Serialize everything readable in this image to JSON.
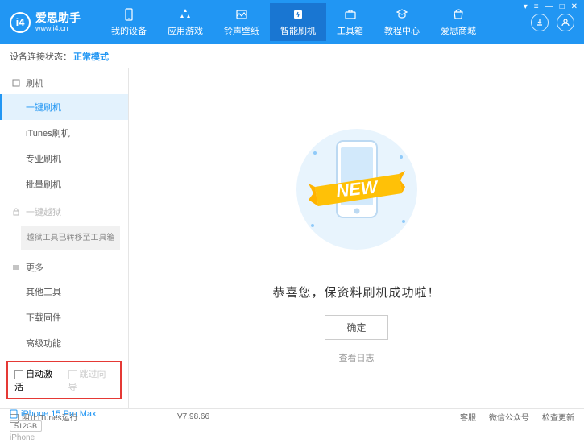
{
  "app": {
    "title": "爱思助手",
    "url": "www.i4.cn"
  },
  "nav": [
    {
      "label": "我的设备"
    },
    {
      "label": "应用游戏"
    },
    {
      "label": "铃声壁纸"
    },
    {
      "label": "智能刷机",
      "active": true
    },
    {
      "label": "工具箱"
    },
    {
      "label": "教程中心"
    },
    {
      "label": "爱思商城"
    }
  ],
  "status": {
    "label": "设备连接状态：",
    "value": "正常模式"
  },
  "sidebar": {
    "flash_section": "刷机",
    "flash_items": [
      "一键刷机",
      "iTunes刷机",
      "专业刷机",
      "批量刷机"
    ],
    "flash_active": 0,
    "jailbreak_section": "一键越狱",
    "jailbreak_note": "越狱工具已转移至工具箱",
    "more_section": "更多",
    "more_items": [
      "其他工具",
      "下载固件",
      "高级功能"
    ],
    "options": {
      "auto_activate": "自动激活",
      "skip_guide": "跳过向导"
    }
  },
  "device": {
    "name": "iPhone 15 Pro Max",
    "storage": "512GB",
    "type": "iPhone"
  },
  "main": {
    "ribbon": "NEW",
    "success": "恭喜您，保资料刷机成功啦！",
    "ok": "确定",
    "view_log": "查看日志"
  },
  "footer": {
    "block_itunes": "阻止iTunes运行",
    "version": "V7.98.66",
    "links": [
      "客服",
      "微信公众号",
      "检查更新"
    ]
  }
}
